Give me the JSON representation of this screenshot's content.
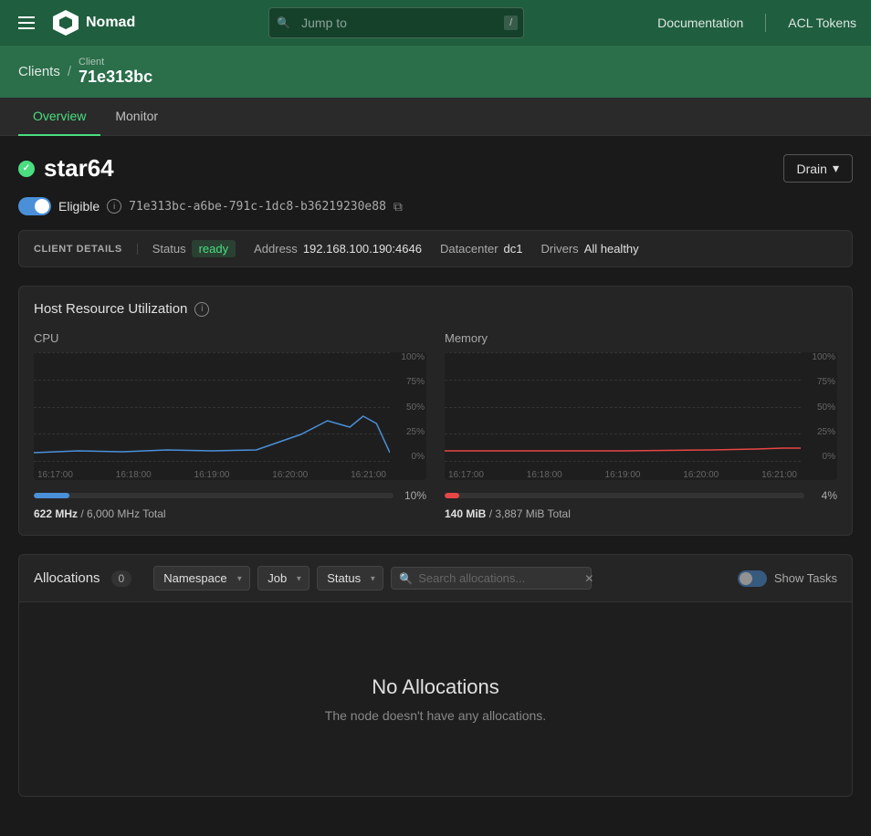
{
  "nav": {
    "hamburger_label": "Menu",
    "logo_text": "Nomad",
    "jump_to_placeholder": "Jump to",
    "slash_key": "/",
    "doc_link": "Documentation",
    "acl_link": "ACL Tokens"
  },
  "breadcrumb": {
    "parent": "Clients",
    "separator": "/",
    "client_label": "Client",
    "current": "71e313bc"
  },
  "tabs": [
    {
      "id": "overview",
      "label": "Overview",
      "active": true
    },
    {
      "id": "monitor",
      "label": "Monitor",
      "active": false
    }
  ],
  "node": {
    "name": "star64",
    "status_icon": "check",
    "drain_button": "Drain",
    "eligible_label": "Eligible",
    "node_id": "71e313bc-a6be-791c-1dc8-b36219230e88"
  },
  "client_details": {
    "section_title": "CLIENT DETAILS",
    "status_label": "Status",
    "status_value": "ready",
    "address_label": "Address",
    "address_value": "192.168.100.190:4646",
    "datacenter_label": "Datacenter",
    "datacenter_value": "dc1",
    "drivers_label": "Drivers",
    "drivers_value": "All healthy"
  },
  "resources": {
    "section_title": "Host Resource Utilization",
    "cpu": {
      "label": "CPU",
      "y_labels": [
        "100%",
        "75%",
        "50%",
        "25%",
        "0%"
      ],
      "x_labels": [
        "16:17:00",
        "16:18:00",
        "16:19:00",
        "16:20:00",
        "16:21:00"
      ],
      "progress_pct": "10%",
      "used": "622 MHz",
      "total": "6,000 MHz Total"
    },
    "memory": {
      "label": "Memory",
      "y_labels": [
        "100%",
        "75%",
        "50%",
        "25%",
        "0%"
      ],
      "x_labels": [
        "16:17:00",
        "16:18:00",
        "16:19:00",
        "16:20:00",
        "16:21:00"
      ],
      "progress_pct": "4%",
      "used": "140 MiB",
      "total": "3,887 MiB Total"
    }
  },
  "allocations": {
    "title": "Allocations",
    "count": "0",
    "namespace_label": "Namespace",
    "job_label": "Job",
    "status_label": "Status",
    "search_placeholder": "Search allocations...",
    "show_tasks_label": "Show Tasks",
    "empty_title": "No Allocations",
    "empty_sub": "The node doesn't have any allocations."
  }
}
